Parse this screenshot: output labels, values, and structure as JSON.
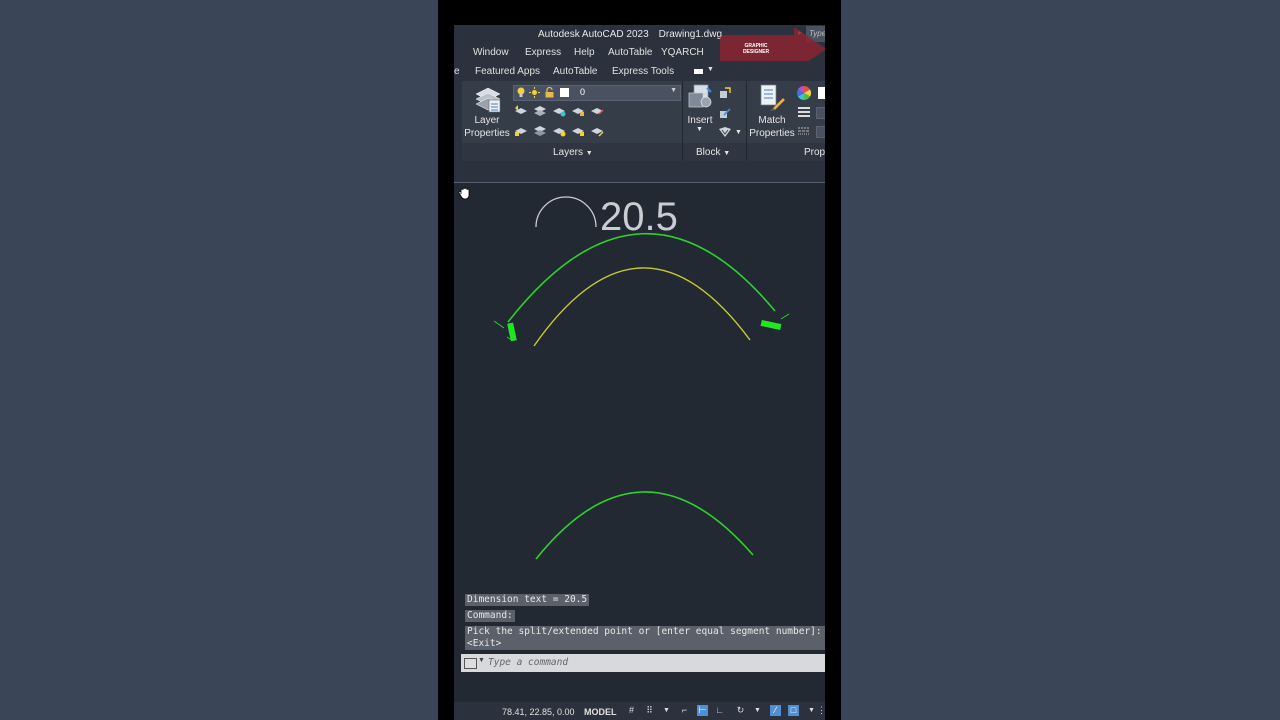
{
  "window": {
    "app_title": "Autodesk AutoCAD 2023",
    "file_name": "Drawing1.dwg",
    "search_placeholder": "Type"
  },
  "menubar": {
    "items": [
      "Window",
      "Express",
      "Help",
      "AutoTable",
      "YQARCH"
    ]
  },
  "watermark": {
    "text": "GRAPHIC DESIGNER"
  },
  "ribbon_tabs": {
    "items": [
      "e",
      "Featured Apps",
      "AutoTable",
      "Express Tools"
    ]
  },
  "ribbon": {
    "layer_properties": {
      "line1": "Layer",
      "line2": "Properties"
    },
    "layer_combo_value": "0",
    "layers_panel_title": "Layers",
    "insert_label": "Insert",
    "block_panel_title": "Block",
    "match_properties": {
      "line1": "Match",
      "line2": "Properties"
    },
    "properties_panel_title": "Prope"
  },
  "canvas": {
    "dimension_value": "20.5"
  },
  "command_history": {
    "line1": "Dimension text = 20.5",
    "line2": "Command:",
    "line3": "Pick the split/extended point or [enter equal segment number]:",
    "line4": "<Exit>"
  },
  "command_input": {
    "placeholder": "Type a command"
  },
  "statusbar": {
    "coords": "78.41, 22.85, 0.00",
    "model": "MODEL"
  },
  "colors": {
    "arc_green": "#2ed12e",
    "arc_yellow": "#c8c832",
    "grip_green": "#22e622",
    "status_active": "#4f8fd6"
  }
}
